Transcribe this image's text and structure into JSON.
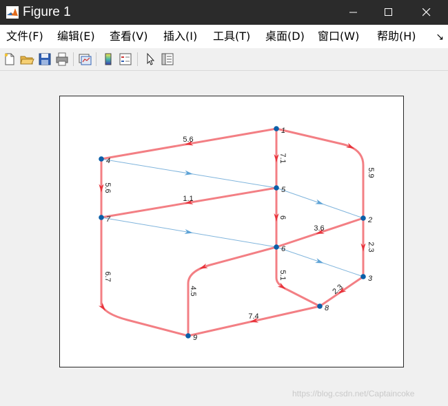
{
  "window": {
    "title": "Figure 1"
  },
  "menu": {
    "items": [
      "文件(F)",
      "编辑(E)",
      "查看(V)",
      "插入(I)",
      "工具(T)",
      "桌面(D)",
      "窗口(W)",
      "帮助(H)"
    ]
  },
  "toolbar": {
    "buttons": [
      "new-figure-icon",
      "open-file-icon",
      "save-icon",
      "print-icon",
      "link-plot-icon",
      "insert-colorbar-icon",
      "insert-legend-icon",
      "pointer-icon",
      "property-inspector-icon"
    ]
  },
  "colors": {
    "edge_main": "#f2787d",
    "edge_light": "#7fb4dc",
    "node": "#0b5fa8",
    "titlebar": "#2b2b2b"
  },
  "graph": {
    "nodes": [
      {
        "id": "1",
        "label": "1"
      },
      {
        "id": "2",
        "label": "2"
      },
      {
        "id": "3",
        "label": "3"
      },
      {
        "id": "4",
        "label": "4"
      },
      {
        "id": "5",
        "label": "5"
      },
      {
        "id": "6",
        "label": "6"
      },
      {
        "id": "7",
        "label": "7"
      },
      {
        "id": "8",
        "label": "8"
      },
      {
        "id": "9",
        "label": "9"
      }
    ],
    "edges": [
      {
        "from": "1",
        "to": "4",
        "weight": "5.6",
        "style": "main"
      },
      {
        "from": "1",
        "to": "2",
        "weight": "5.9",
        "style": "main"
      },
      {
        "from": "1",
        "to": "5",
        "weight": "7.1",
        "style": "main"
      },
      {
        "from": "4",
        "to": "7",
        "weight": "5.6",
        "style": "main"
      },
      {
        "from": "4",
        "to": "5",
        "weight": "",
        "style": "light"
      },
      {
        "from": "5",
        "to": "7",
        "weight": "1.1",
        "style": "main"
      },
      {
        "from": "5",
        "to": "6",
        "weight": "6",
        "style": "main"
      },
      {
        "from": "5",
        "to": "2",
        "weight": "",
        "style": "light"
      },
      {
        "from": "2",
        "to": "6",
        "weight": "3.6",
        "style": "main"
      },
      {
        "from": "2",
        "to": "3",
        "weight": "2.3",
        "style": "main"
      },
      {
        "from": "7",
        "to": "6",
        "weight": "",
        "style": "light"
      },
      {
        "from": "7",
        "to": "9",
        "weight": "6.7",
        "style": "main"
      },
      {
        "from": "6",
        "to": "3",
        "weight": "",
        "style": "light"
      },
      {
        "from": "6",
        "to": "9",
        "weight": "4.5",
        "style": "main"
      },
      {
        "from": "6",
        "to": "8",
        "weight": "5.1",
        "style": "main"
      },
      {
        "from": "3",
        "to": "8",
        "weight": "2.3",
        "style": "main"
      },
      {
        "from": "8",
        "to": "9",
        "weight": "7.4",
        "style": "main"
      }
    ]
  },
  "watermark": "https://blog.csdn.net/Captaincoke"
}
